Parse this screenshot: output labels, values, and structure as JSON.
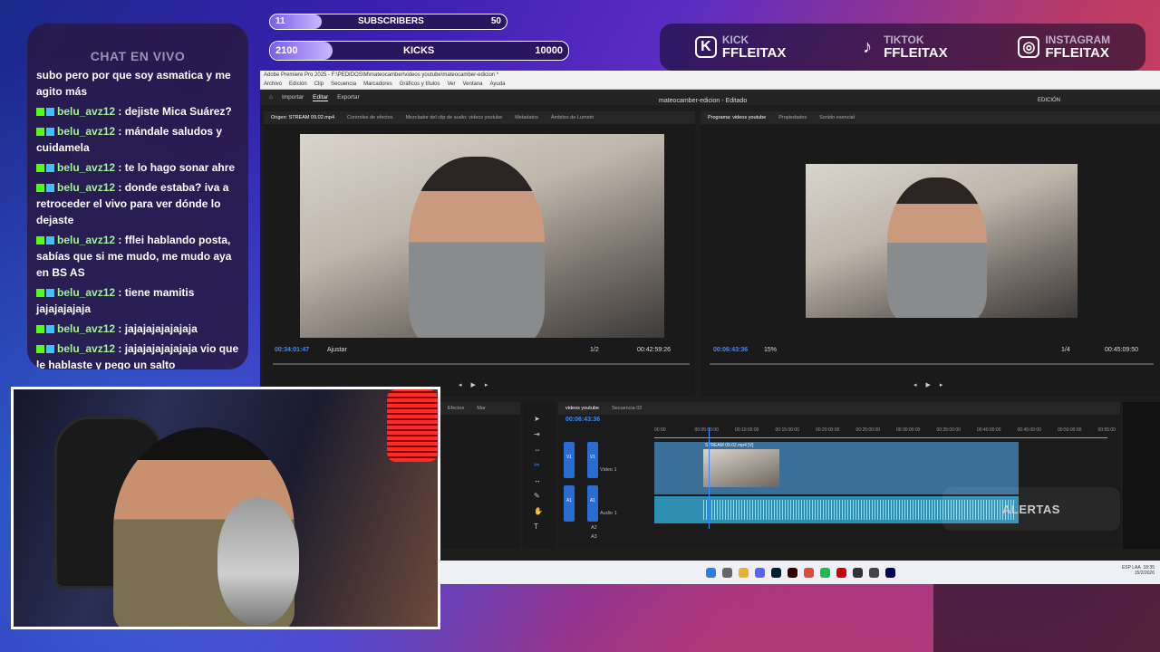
{
  "chat": {
    "title": "CHAT EN VIVO",
    "messages": [
      {
        "user": "",
        "text": "subo pero por que soy asmatica y me agito más"
      },
      {
        "user": "belu_avz12",
        "text": " : dejiste Mica Suárez?"
      },
      {
        "user": "belu_avz12",
        "text": " : mándale saludos y cuidamela"
      },
      {
        "user": "belu_avz12",
        "text": " : te lo hago sonar ahre"
      },
      {
        "user": "belu_avz12",
        "text": " : donde estaba? iva a retroceder el vivo para ver dónde lo dejaste"
      },
      {
        "user": "belu_avz12",
        "text": " : fflei hablando posta, sabías que si me mudo, me mudo aya en BS AS"
      },
      {
        "user": "belu_avz12",
        "text": " : tiene mamitis jajajajajaja"
      },
      {
        "user": "belu_avz12",
        "text": " : jajajajajajajaja"
      },
      {
        "user": "belu_avz12",
        "text": " : jajajajajajajaja vio que le hablaste y pego un salto"
      }
    ]
  },
  "goals": {
    "subscribers": {
      "current": "11",
      "label": "SUBSCRIBERS",
      "target": "50",
      "fraction": 0.22
    },
    "kicks": {
      "current": "2100",
      "label": "KICKS",
      "target": "10000",
      "fraction": 0.21
    }
  },
  "socials": [
    {
      "platform": "KICK",
      "handle": "FFLEITAX",
      "icon": "kick-icon",
      "glyph": "K"
    },
    {
      "platform": "TIKTOK",
      "handle": "FFLEITAX",
      "icon": "tiktok-icon",
      "glyph": "♪"
    },
    {
      "platform": "INSTAGRAM",
      "handle": "FFLEITAX",
      "icon": "instagram-icon",
      "glyph": "◎"
    }
  ],
  "premiere": {
    "window_title": "Adobe Premiere Pro 2025 - F:\\PEDIDOS\\M\\mateocamber\\videos youtube\\mateocamber-edicion *",
    "menu": [
      "Archivo",
      "Edición",
      "Clip",
      "Secuencia",
      "Marcadores",
      "Gráficos y títulos",
      "Ver",
      "Ventana",
      "Ayuda"
    ],
    "workspace_tabs": [
      "Importar",
      "Editar",
      "Exportar"
    ],
    "project_title": "mateocamber-edicion - Editado",
    "edition_label": "EDICIÓN",
    "source_tabs": [
      "Origen: STREAM 09.02.mp4",
      "Controles de efectos",
      "Mezclador del clip de audio: videos youtube",
      "Metadatos",
      "Ámbitos de Lumetri"
    ],
    "program_tabs": [
      "Programa: videos youtube",
      "Propiedades",
      "Sonido esencial"
    ],
    "source_timecode": "00:34:01:47",
    "source_fit": "Ajustar",
    "source_res": "1/2",
    "source_duration": "00:42:59:26",
    "program_timecode": "00:06:43:36",
    "program_zoom": "15%",
    "program_res": "1/4",
    "program_duration": "00:45:09:50",
    "left_tabs": [
      "Efectos",
      "Mar"
    ],
    "timeline_tabs": [
      "videos youtube",
      "Secuencia 02"
    ],
    "timeline_timecode": "00:06:43:36",
    "ruler": [
      "00:00",
      "00:05:00:00",
      "00:10:00:00",
      "00:15:00:00",
      "00:20:00:00",
      "00:25:00:00",
      "00:30:00:00",
      "00:35:00:00",
      "00:40:00:00",
      "00:45:00:00",
      "00:50:00:00",
      "00:55:00"
    ],
    "clip_name": "STREAM 09.02.mp4 [V]",
    "tracks": {
      "v1": "V1",
      "video1": "Video 1",
      "a1": "A1",
      "audio1": "Audio 1",
      "a2": "A2",
      "a3": "A3"
    },
    "tray": {
      "lang": "ESP LAA",
      "time": "18:35",
      "date": "15/2/2026"
    }
  },
  "overlay": {
    "alerts_label": "ALERTAS"
  },
  "colors": {
    "accent": "#53fc18",
    "premiere_blue": "#3b8cff",
    "bar_fill": "#9b7bf0"
  }
}
